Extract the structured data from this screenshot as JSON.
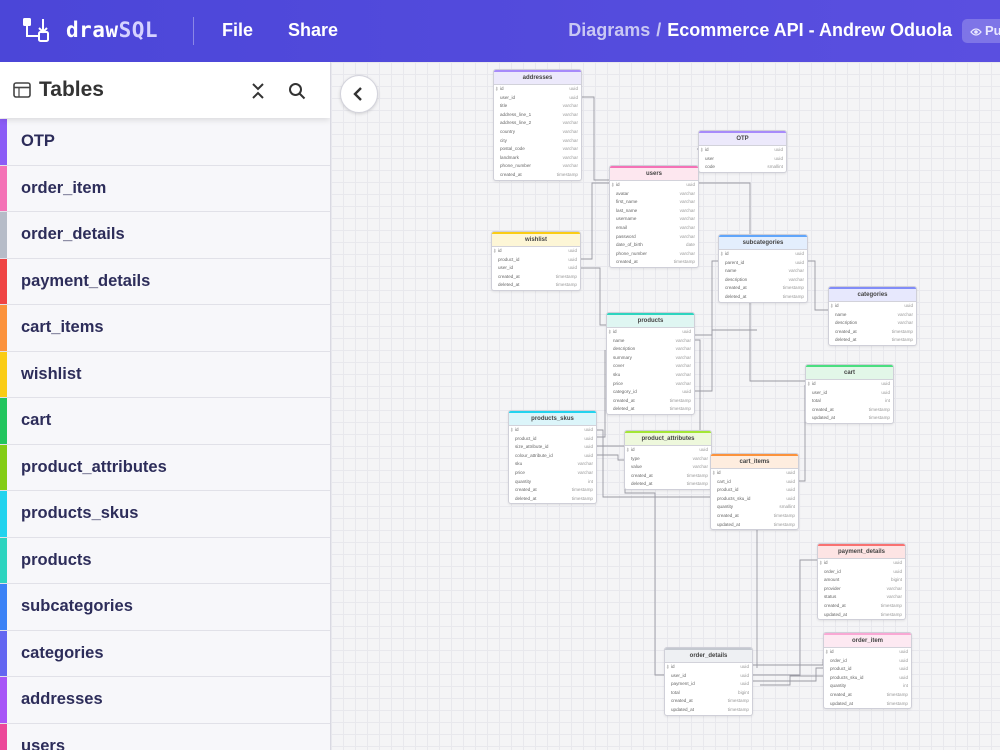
{
  "app": {
    "brand_a": "draw",
    "brand_b": "SQL"
  },
  "menu": {
    "file": "File",
    "share": "Share"
  },
  "breadcrumb": {
    "root": "Diagrams",
    "separator": "/",
    "current": "Ecommerce API - Andrew Oduola",
    "badge": "Pu"
  },
  "sidebar": {
    "title": "Tables",
    "items": [
      {
        "label": "OTP",
        "color": "#8b5cf6"
      },
      {
        "label": "order_item",
        "color": "#f472b6"
      },
      {
        "label": "order_details",
        "color": "#b6bcc8"
      },
      {
        "label": "payment_details",
        "color": "#ef4444"
      },
      {
        "label": "cart_items",
        "color": "#fb923c"
      },
      {
        "label": "wishlist",
        "color": "#facc15"
      },
      {
        "label": "cart",
        "color": "#22c55e"
      },
      {
        "label": "product_attributes",
        "color": "#84cc16"
      },
      {
        "label": "products_skus",
        "color": "#22d3ee"
      },
      {
        "label": "products",
        "color": "#2dd4bf"
      },
      {
        "label": "subcategories",
        "color": "#3b82f6"
      },
      {
        "label": "categories",
        "color": "#6366f1"
      },
      {
        "label": "addresses",
        "color": "#a855f7"
      },
      {
        "label": "users",
        "color": "#ec4899"
      }
    ]
  },
  "tables": [
    {
      "name": "addresses",
      "color": "#a78bfa",
      "head_bg": "#ece9fb",
      "cols": [
        [
          "id",
          "uuid"
        ],
        [
          "user_id",
          "uuid"
        ],
        [
          "title",
          "varchar"
        ],
        [
          "address_line_1",
          "varchar"
        ],
        [
          "address_line_2",
          "varchar"
        ],
        [
          "country",
          "varchar"
        ],
        [
          "city",
          "varchar"
        ],
        [
          "postal_code",
          "varchar"
        ],
        [
          "landmark",
          "varchar"
        ],
        [
          "phone_number",
          "varchar"
        ],
        [
          "created_at",
          "timestamp"
        ]
      ]
    },
    {
      "name": "OTP",
      "color": "#a78bfa",
      "head_bg": "#ece9fb",
      "cols": [
        [
          "id",
          "uuid"
        ],
        [
          "user",
          "uuid"
        ],
        [
          "code",
          "smallint"
        ]
      ]
    },
    {
      "name": "users",
      "color": "#f472b6",
      "head_bg": "#fde7ef",
      "cols": [
        [
          "id",
          "uuid"
        ],
        [
          "avatar",
          "varchar"
        ],
        [
          "first_name",
          "varchar"
        ],
        [
          "last_name",
          "varchar"
        ],
        [
          "username",
          "varchar"
        ],
        [
          "email",
          "varchar"
        ],
        [
          "password",
          "varchar"
        ],
        [
          "date_of_birth",
          "date"
        ],
        [
          "phone_number",
          "varchar"
        ],
        [
          "created_at",
          "timestamp"
        ]
      ]
    },
    {
      "name": "wishlist",
      "color": "#facc15",
      "head_bg": "#fdf6d6",
      "cols": [
        [
          "id",
          "uuid"
        ],
        [
          "product_id",
          "uuid"
        ],
        [
          "user_id",
          "uuid"
        ],
        [
          "created_at",
          "timestamp"
        ],
        [
          "deleted_at",
          "timestamp"
        ]
      ]
    },
    {
      "name": "subcategories",
      "color": "#60a5fa",
      "head_bg": "#e3eefd",
      "cols": [
        [
          "id",
          "uuid"
        ],
        [
          "parent_id",
          "uuid"
        ],
        [
          "name",
          "varchar"
        ],
        [
          "description",
          "varchar"
        ],
        [
          "created_at",
          "timestamp"
        ],
        [
          "deleted_at",
          "timestamp"
        ]
      ]
    },
    {
      "name": "categories",
      "color": "#818cf8",
      "head_bg": "#e7e8fd",
      "cols": [
        [
          "id",
          "uuid"
        ],
        [
          "name",
          "varchar"
        ],
        [
          "description",
          "varchar"
        ],
        [
          "created_at",
          "timestamp"
        ],
        [
          "deleted_at",
          "timestamp"
        ]
      ]
    },
    {
      "name": "products",
      "color": "#2dd4bf",
      "head_bg": "#dff6f2",
      "cols": [
        [
          "id",
          "uuid"
        ],
        [
          "name",
          "varchar"
        ],
        [
          "description",
          "varchar"
        ],
        [
          "summary",
          "varchar"
        ],
        [
          "cover",
          "varchar"
        ],
        [
          "sku",
          "varchar"
        ],
        [
          "price",
          "varchar"
        ],
        [
          "category_id",
          "uuid"
        ],
        [
          "created_at",
          "timestamp"
        ],
        [
          "deleted_at",
          "timestamp"
        ]
      ]
    },
    {
      "name": "cart",
      "color": "#4ade80",
      "head_bg": "#e2f7e8",
      "cols": [
        [
          "id",
          "uuid"
        ],
        [
          "user_id",
          "uuid"
        ],
        [
          "total",
          "int"
        ],
        [
          "created_at",
          "timestamp"
        ],
        [
          "updated_at",
          "timestamp"
        ]
      ]
    },
    {
      "name": "products_skus",
      "color": "#22d3ee",
      "head_bg": "#dcf5fa",
      "cols": [
        [
          "id",
          "uuid"
        ],
        [
          "product_id",
          "uuid"
        ],
        [
          "size_attribute_id",
          "uuid"
        ],
        [
          "colour_attribute_id",
          "uuid"
        ],
        [
          "sku",
          "varchar"
        ],
        [
          "price",
          "varchar"
        ],
        [
          "quantity",
          "int"
        ],
        [
          "created_at",
          "timestamp"
        ],
        [
          "deleted_at",
          "timestamp"
        ]
      ]
    },
    {
      "name": "product_attributes",
      "color": "#a3e635",
      "head_bg": "#eef8dc",
      "cols": [
        [
          "id",
          "uuid"
        ],
        [
          "type",
          "varchar"
        ],
        [
          "value",
          "varchar"
        ],
        [
          "created_at",
          "timestamp"
        ],
        [
          "deleted_at",
          "timestamp"
        ]
      ]
    },
    {
      "name": "cart_items",
      "color": "#fb923c",
      "head_bg": "#feeddf",
      "cols": [
        [
          "id",
          "uuid"
        ],
        [
          "cart_id",
          "uuid"
        ],
        [
          "product_id",
          "uuid"
        ],
        [
          "products_sku_id",
          "uuid"
        ],
        [
          "quantity",
          "smallint"
        ],
        [
          "created_at",
          "timestamp"
        ],
        [
          "updated_at",
          "timestamp"
        ]
      ]
    },
    {
      "name": "payment_details",
      "color": "#f87171",
      "head_bg": "#fde4e4",
      "cols": [
        [
          "id",
          "uuid"
        ],
        [
          "order_id",
          "uuid"
        ],
        [
          "amount",
          "bigint"
        ],
        [
          "provider",
          "varchar"
        ],
        [
          "status",
          "varchar"
        ],
        [
          "created_at",
          "timestamp"
        ],
        [
          "updated_at",
          "timestamp"
        ]
      ]
    },
    {
      "name": "order_item",
      "color": "#f9a8d4",
      "head_bg": "#fde9f2",
      "cols": [
        [
          "id",
          "uuid"
        ],
        [
          "order_id",
          "uuid"
        ],
        [
          "product_id",
          "uuid"
        ],
        [
          "products_sku_id",
          "uuid"
        ],
        [
          "quantity",
          "int"
        ],
        [
          "created_at",
          "timestamp"
        ],
        [
          "updated_at",
          "timestamp"
        ]
      ]
    },
    {
      "name": "order_details",
      "color": "#c4c8d0",
      "head_bg": "#eef0f3",
      "cols": [
        [
          "id",
          "uuid"
        ],
        [
          "user_id",
          "uuid"
        ],
        [
          "payment_id",
          "uuid"
        ],
        [
          "total",
          "bigint"
        ],
        [
          "created_at",
          "timestamp"
        ],
        [
          "updated_at",
          "timestamp"
        ]
      ]
    }
  ]
}
